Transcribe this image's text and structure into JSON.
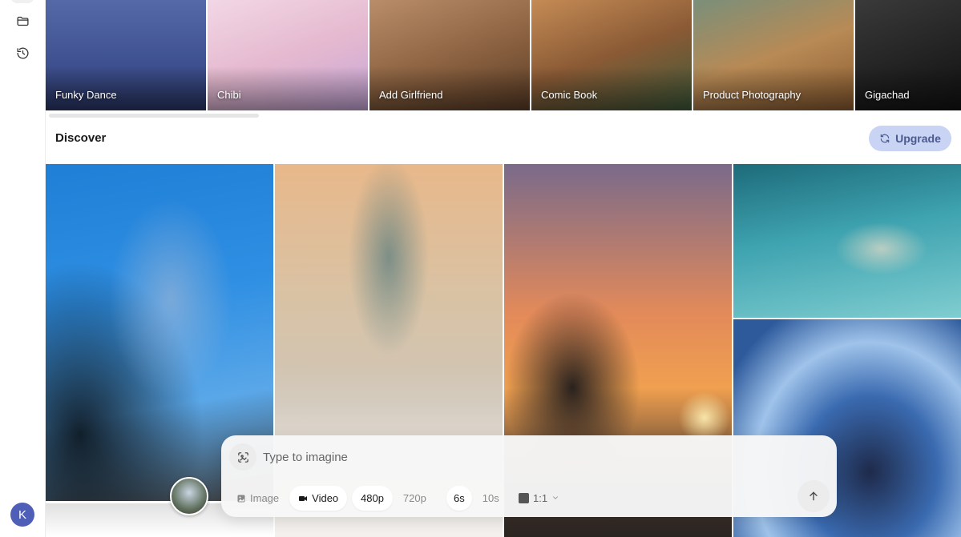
{
  "sidebar": {
    "icons": [
      "folder-icon",
      "history-icon"
    ],
    "avatar_initial": "K"
  },
  "templates": [
    {
      "label": "Funky Dance"
    },
    {
      "label": "Chibi"
    },
    {
      "label": "Add Girlfriend"
    },
    {
      "label": "Comic Book"
    },
    {
      "label": "Product Photography"
    },
    {
      "label": "Gigachad"
    }
  ],
  "discover": {
    "title": "Discover",
    "upgrade_label": "Upgrade"
  },
  "prompt": {
    "placeholder": "Type to imagine",
    "mode_options": [
      "Image",
      "Video"
    ],
    "selected_mode": "Video",
    "resolution_options": [
      "480p",
      "720p"
    ],
    "selected_resolution": "480p",
    "duration_options": [
      "6s",
      "10s"
    ],
    "selected_duration": "6s",
    "aspect_ratio": "1:1"
  },
  "colors": {
    "accent": "#c9d3f3",
    "accent_text": "#4b5a8f",
    "avatar": "#4f5fb8"
  }
}
